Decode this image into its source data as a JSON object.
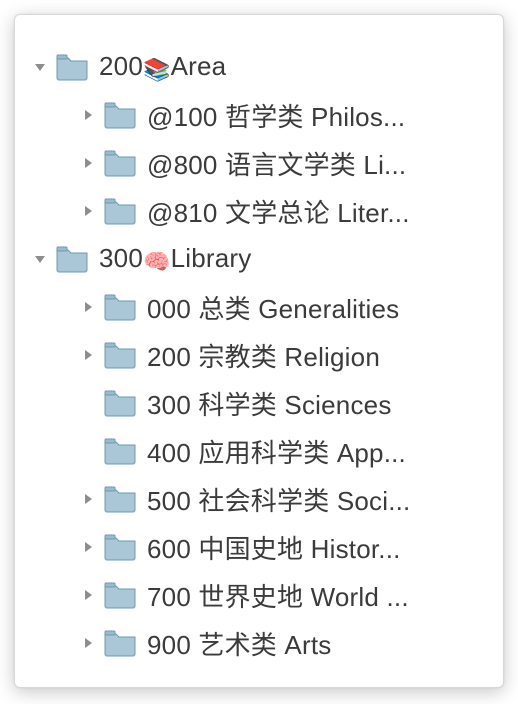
{
  "colors": {
    "arrow": "#8d8d8d",
    "folder_body": "#a9c7d6",
    "folder_border": "#6f98ac",
    "folder_tab": "#9abccd",
    "text": "#3b3b3b"
  },
  "tree": [
    {
      "expanded": true,
      "label_prefix": "200",
      "emoji": "📚",
      "label_suffix": "Area",
      "children": [
        {
          "expanded": false,
          "label": "@100 哲学类 Philos..."
        },
        {
          "expanded": false,
          "label": "@800 语言文学类 Li..."
        },
        {
          "expanded": false,
          "label": "@810 文学总论 Liter..."
        }
      ]
    },
    {
      "expanded": true,
      "label_prefix": "300",
      "emoji": "🧠",
      "label_suffix": "Library",
      "children": [
        {
          "expanded": false,
          "label": "000 总类 Generalities"
        },
        {
          "expanded": false,
          "label": "200 宗教类 Religion"
        },
        {
          "expanded": null,
          "label": "300 科学类 Sciences"
        },
        {
          "expanded": null,
          "label": "400 应用科学类 App..."
        },
        {
          "expanded": false,
          "label": "500 社会科学类 Soci..."
        },
        {
          "expanded": false,
          "label": "600 中国史地 Histor..."
        },
        {
          "expanded": false,
          "label": "700 世界史地 World ..."
        },
        {
          "expanded": false,
          "label": "900 艺术类 Arts"
        }
      ]
    }
  ]
}
